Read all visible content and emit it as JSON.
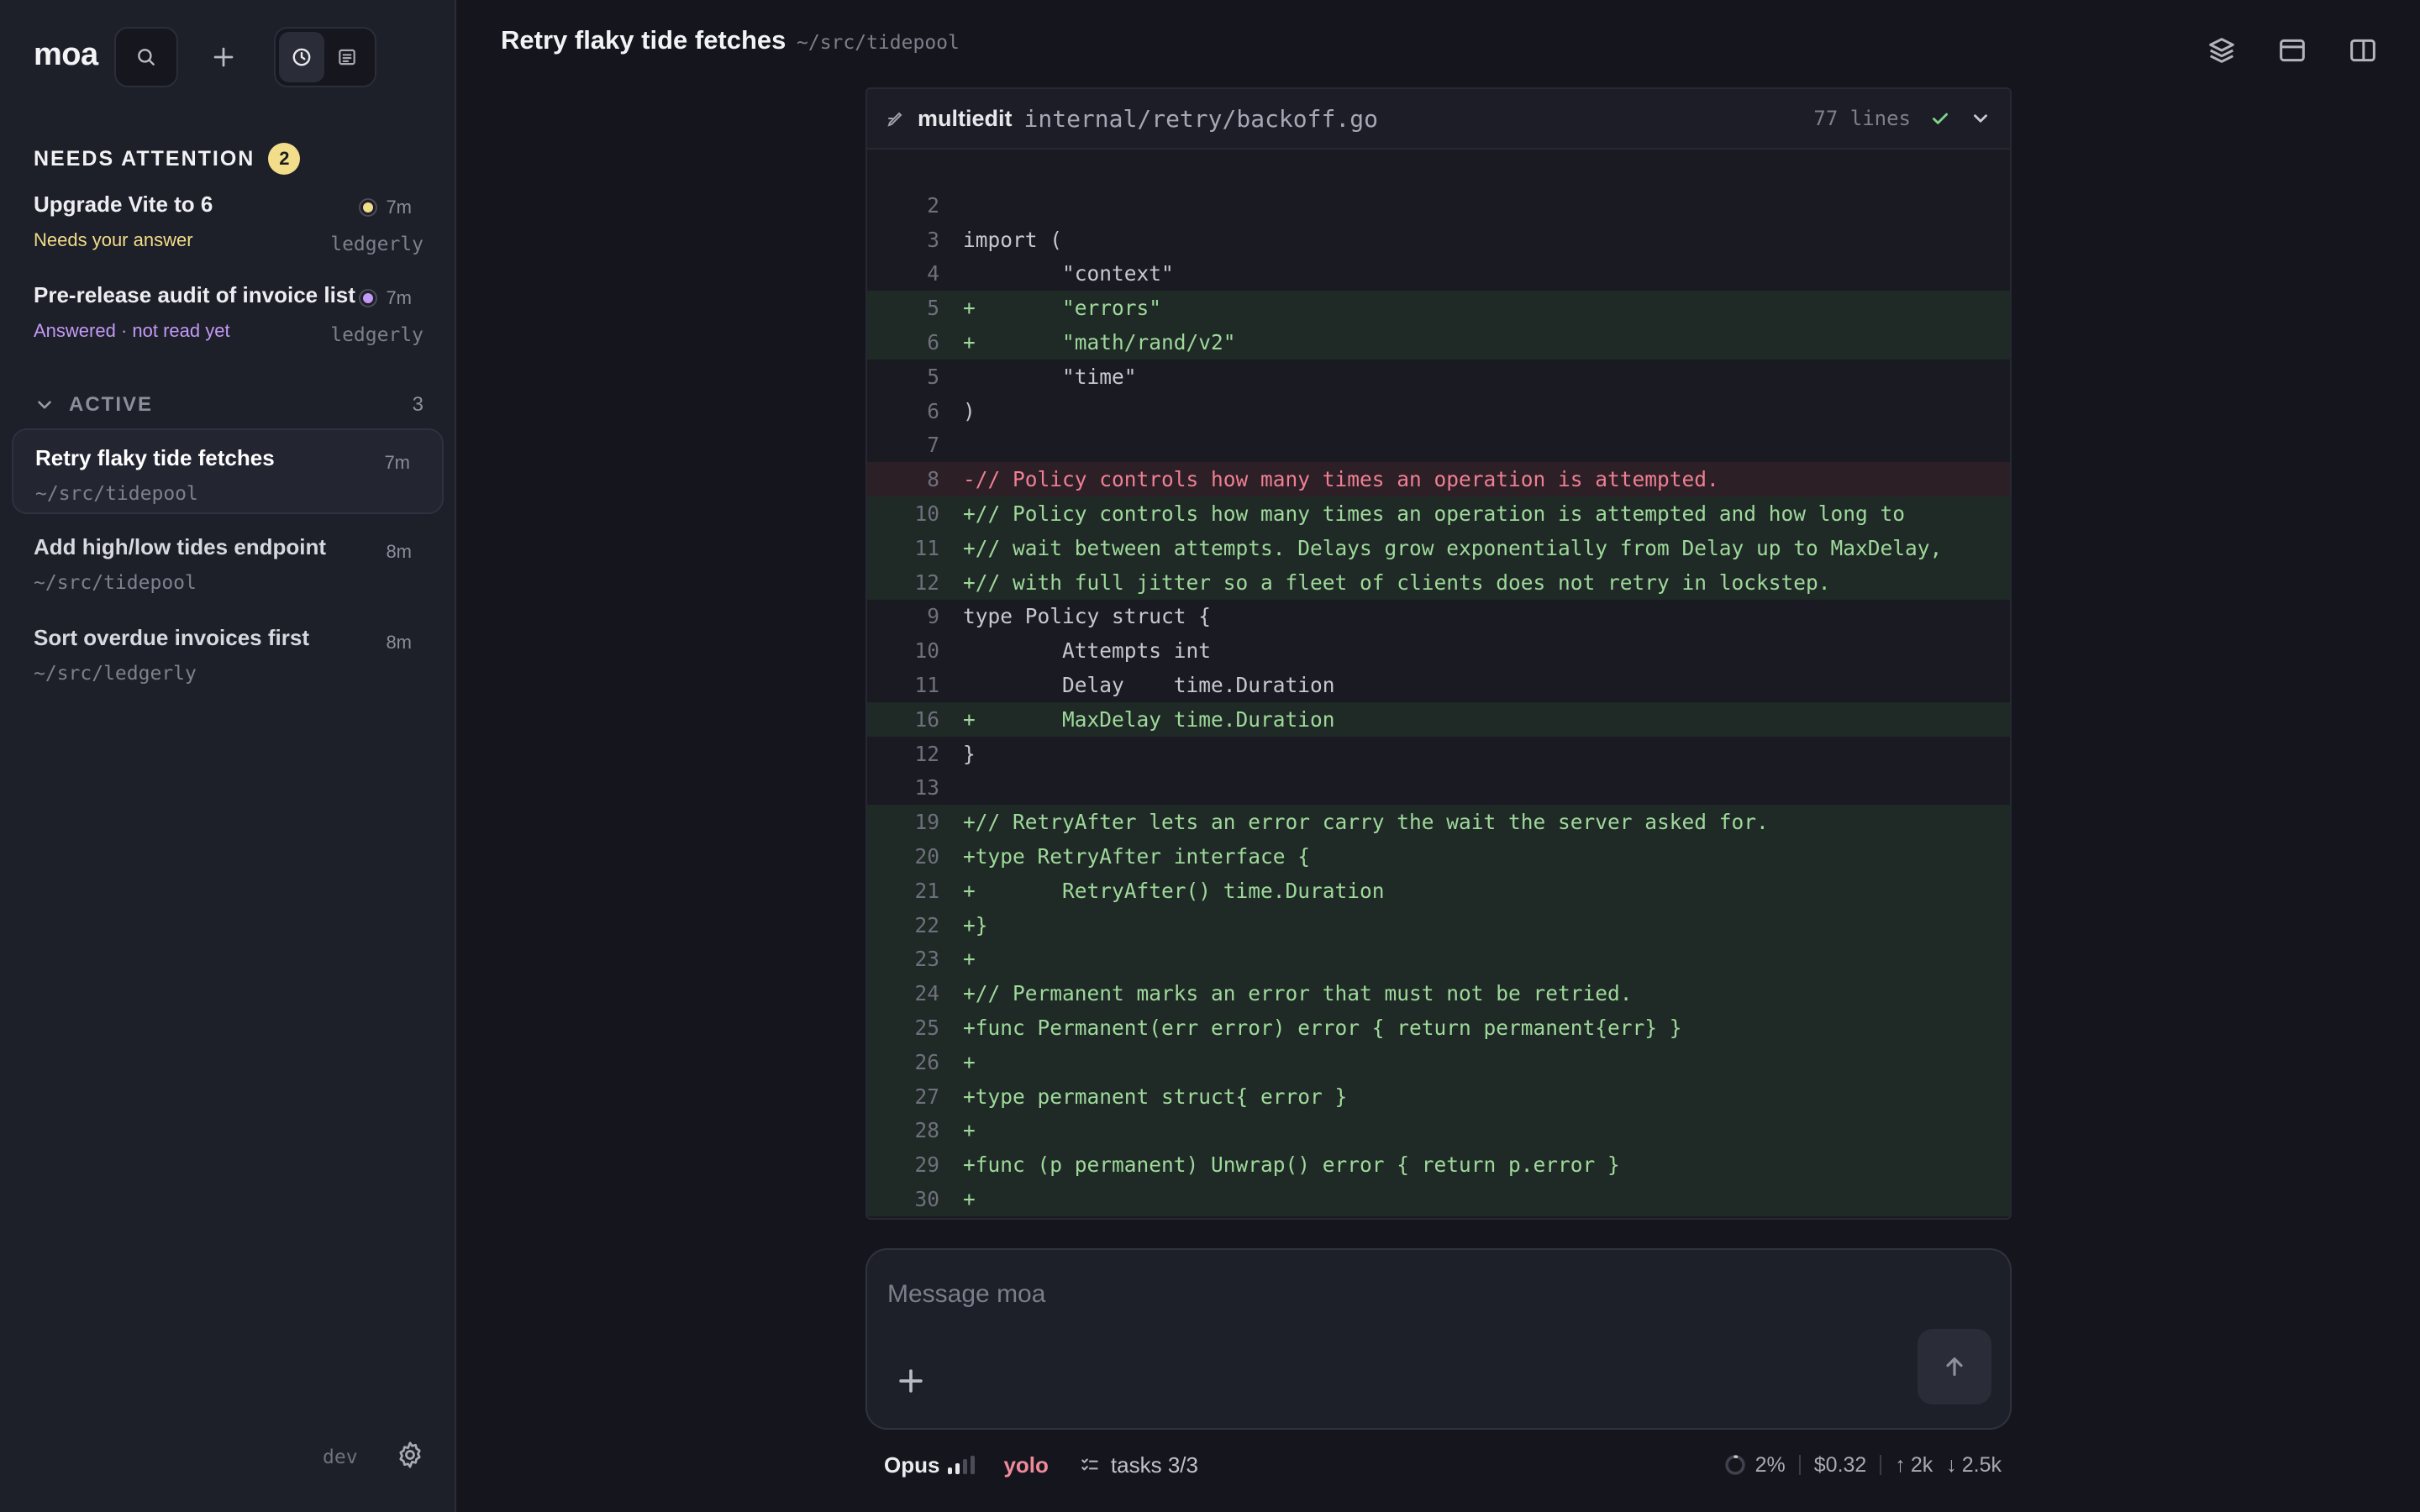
{
  "sidebar": {
    "brand": "moa",
    "needs_attention": {
      "title": "NEEDS ATTENTION",
      "count": "2",
      "items": [
        {
          "title": "Upgrade Vite to 6",
          "status": "Needs your answer",
          "status_color": "#f2dd8a",
          "time": "7m",
          "repo": "ledgerly"
        },
        {
          "title": "Pre-release audit of invoice list",
          "status": "Answered · not read yet",
          "status_color": "#c39af5",
          "time": "7m",
          "repo": "ledgerly"
        }
      ]
    },
    "active": {
      "title": "ACTIVE",
      "count": "3",
      "items": [
        {
          "title": "Retry flaky tide fetches",
          "path": "~/src/tidepool",
          "time": "7m",
          "selected": true
        },
        {
          "title": "Add high/low tides endpoint",
          "path": "~/src/tidepool",
          "time": "8m"
        },
        {
          "title": "Sort overdue invoices first",
          "path": "~/src/ledgerly",
          "time": "8m"
        }
      ]
    },
    "env": "dev"
  },
  "header": {
    "title": "Retry flaky tide fetches",
    "path": "~/src/tidepool"
  },
  "diff": {
    "tool": "multiedit",
    "file": "internal/retry/backoff.go",
    "lines": "77 lines",
    "rows": [
      {
        "n": "2",
        "t": "",
        "k": ""
      },
      {
        "n": "3",
        "t": "import (",
        "k": ""
      },
      {
        "n": "4",
        "t": "        \"context\"",
        "k": ""
      },
      {
        "n": "5",
        "t": "+       \"errors\"",
        "k": "add"
      },
      {
        "n": "6",
        "t": "+       \"math/rand/v2\"",
        "k": "add"
      },
      {
        "n": "5",
        "t": "        \"time\"",
        "k": ""
      },
      {
        "n": "6",
        "t": ")",
        "k": ""
      },
      {
        "n": "7",
        "t": "",
        "k": ""
      },
      {
        "n": "8",
        "t": "-// Policy controls how many times an operation is attempted.",
        "k": "del"
      },
      {
        "n": "10",
        "t": "+// Policy controls how many times an operation is attempted and how long to",
        "k": "add"
      },
      {
        "n": "11",
        "t": "+// wait between attempts. Delays grow exponentially from Delay up to MaxDelay,",
        "k": "add"
      },
      {
        "n": "12",
        "t": "+// with full jitter so a fleet of clients does not retry in lockstep.",
        "k": "add"
      },
      {
        "n": "9",
        "t": "type Policy struct {",
        "k": ""
      },
      {
        "n": "10",
        "t": "        Attempts int",
        "k": ""
      },
      {
        "n": "11",
        "t": "        Delay    time.Duration",
        "k": ""
      },
      {
        "n": "16",
        "t": "+       MaxDelay time.Duration",
        "k": "add"
      },
      {
        "n": "12",
        "t": "}",
        "k": ""
      },
      {
        "n": "13",
        "t": "",
        "k": ""
      },
      {
        "n": "19",
        "t": "+// RetryAfter lets an error carry the wait the server asked for.",
        "k": "add"
      },
      {
        "n": "20",
        "t": "+type RetryAfter interface {",
        "k": "add"
      },
      {
        "n": "21",
        "t": "+       RetryAfter() time.Duration",
        "k": "add"
      },
      {
        "n": "22",
        "t": "+}",
        "k": "add"
      },
      {
        "n": "23",
        "t": "+",
        "k": "add"
      },
      {
        "n": "24",
        "t": "+// Permanent marks an error that must not be retried.",
        "k": "add"
      },
      {
        "n": "25",
        "t": "+func Permanent(err error) error { return permanent{err} }",
        "k": "add"
      },
      {
        "n": "26",
        "t": "+",
        "k": "add"
      },
      {
        "n": "27",
        "t": "+type permanent struct{ error }",
        "k": "add"
      },
      {
        "n": "28",
        "t": "+",
        "k": "add"
      },
      {
        "n": "29",
        "t": "+func (p permanent) Unwrap() error { return p.error }",
        "k": "add"
      },
      {
        "n": "30",
        "t": "+",
        "k": "add"
      }
    ]
  },
  "composer": {
    "placeholder": "Message moa"
  },
  "footer": {
    "model": "Opus",
    "mode": "yolo",
    "tasks": "tasks 3/3",
    "context_pct": "2%",
    "cost": "$0.32",
    "tokens_up": "2k",
    "tokens_down": "2.5k"
  },
  "icons": {
    "search": "search-icon",
    "new": "plus-icon",
    "history": "clock-icon",
    "files": "file-list-icon",
    "settings": "gear-icon",
    "layers": "layers-icon",
    "panel": "window-icon",
    "split": "split-view-icon",
    "edit": "pencil-icon",
    "check": "check-icon",
    "collapse": "chevron-down-icon",
    "attach": "plus-icon",
    "send": "arrow-up-icon"
  },
  "colors": {
    "accent_yellow": "#f2dd8a",
    "accent_purple": "#c39af5",
    "added": "#9ed99a",
    "removed": "#ef7f93",
    "mode": "#f08a9a"
  }
}
